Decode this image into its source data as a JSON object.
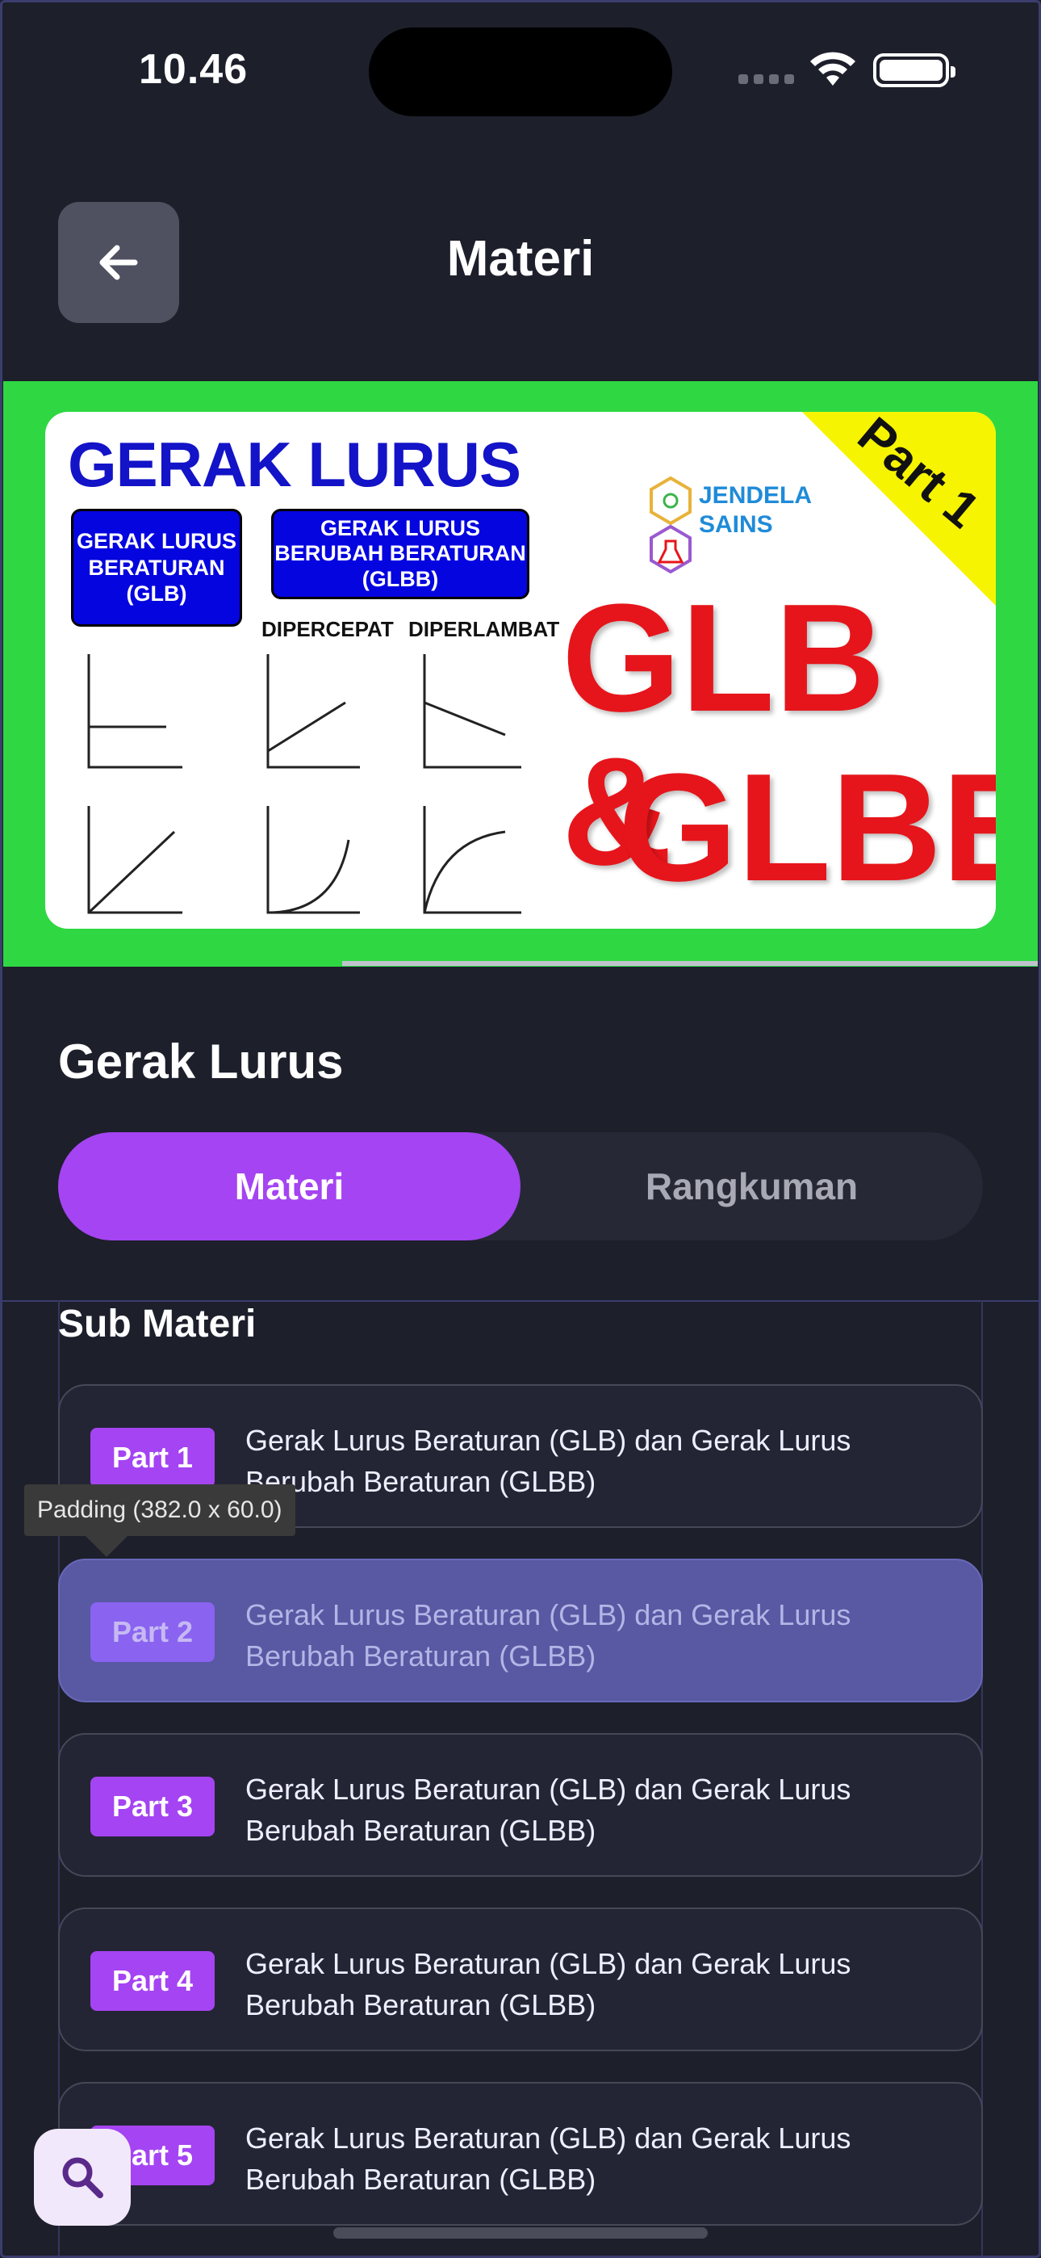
{
  "status_bar": {
    "time": "10.46"
  },
  "header": {
    "title": "Materi",
    "back_icon": "arrow-left-icon"
  },
  "banner": {
    "title": "GERAK LURUS",
    "box_glb": "GERAK LURUS BERATURAN (GLB)",
    "box_glbb": "GERAK LURUS BERUBAH BERATURAN (GLBB)",
    "caption_dipercepat": "DIPERCEPAT",
    "caption_diperlambat": "DIPERLAMBAT",
    "big_text_line1": "GLB &",
    "big_text_line2": "GLBB",
    "corner_label": "Part 1",
    "logo_text": "JENDELA SAINS"
  },
  "section": {
    "title": "Gerak Lurus"
  },
  "tabs": [
    {
      "label": "Materi",
      "active": true
    },
    {
      "label": "Rangkuman",
      "active": false
    }
  ],
  "sub_materi": {
    "title": "Sub Materi",
    "items": [
      {
        "badge": "Part 1",
        "line1": "Gerak Lurus Beraturan (GLB) dan Gerak Lurus",
        "line2": "Berubah Beraturan (GLBB)"
      },
      {
        "badge": "Part 2",
        "line1": "Gerak Lurus Beraturan (GLB) dan Gerak Lurus",
        "line2": "Berubah Beraturan (GLBB)"
      },
      {
        "badge": "Part 3",
        "line1": "Gerak Lurus Beraturan (GLB) dan Gerak Lurus",
        "line2": "Berubah Beraturan (GLBB)"
      },
      {
        "badge": "Part 4",
        "line1": "Gerak Lurus Beraturan (GLB) dan Gerak Lurus",
        "line2": "Berubah Beraturan (GLBB)"
      },
      {
        "badge": "Part 5",
        "line1": "Gerak Lurus Beraturan (GLB) dan Gerak Lurus",
        "line2": "Berubah Beraturan (GLBB)"
      }
    ]
  },
  "debug_tooltip": "Padding (382.0 x 60.0)",
  "fab": {
    "icon": "search-icon"
  },
  "colors": {
    "accent": "#a544f2",
    "background": "#1d1f2b",
    "highlight": "#5858a3"
  }
}
